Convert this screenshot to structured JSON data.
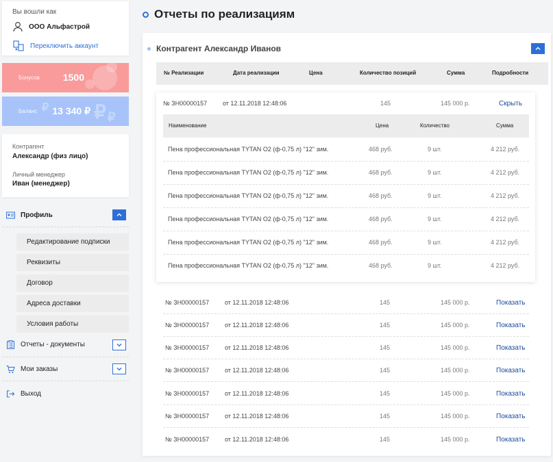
{
  "sidebar": {
    "login_title": "Вы вошли как",
    "company": "ООО Альфастрой",
    "switch_account": "Переключить аккаунт",
    "bonus": {
      "label": "Бонусов",
      "value": "1500"
    },
    "balance": {
      "label": "Баланс",
      "value": "13 340 ₽"
    },
    "contractor_label": "Контрагент",
    "contractor_value": "Александр (физ лицо)",
    "manager_label": "Личный менеджер",
    "manager_value": "Иван (менеджер)",
    "profile_label": "Профиль",
    "profile_items": [
      "Редактирование подписки",
      "Реквизиты",
      "Договор",
      "Адреса доставки",
      "Условия работы"
    ],
    "reports_label": "Отчеты - документы",
    "orders_label": "Мои заказы",
    "logout_label": "Выход"
  },
  "main": {
    "page_title": "Отчеты по реализациям",
    "contractor_name": "Контрагент Александр Иванов",
    "columns": [
      "№ Реализации",
      "Дата реализации",
      "Цена",
      "Количество позиций",
      "Сумма",
      "Подробности"
    ],
    "expanded": {
      "number": "№ ЗН00000157",
      "date": "от 12.11.2018 12:48:06",
      "positions": "145",
      "sum": "145 000 р.",
      "action": "Скрыть",
      "item_columns": [
        "Наименование",
        "Цена",
        "Количество",
        "Сумма"
      ],
      "items": [
        {
          "name": "Пена профессиональная TYTAN O2 (ф-0,75 л) \"12\" зим.",
          "price": "468 руб.",
          "qty": "9 шт.",
          "sum": "4 212 руб."
        },
        {
          "name": "Пена профессиональная TYTAN O2 (ф-0,75 л) \"12\" зим.",
          "price": "468 руб.",
          "qty": "9 шт.",
          "sum": "4 212 руб."
        },
        {
          "name": "Пена профессиональная TYTAN O2 (ф-0,75 л) \"12\" зим.",
          "price": "468 руб.",
          "qty": "9 шт.",
          "sum": "4 212 руб."
        },
        {
          "name": "Пена профессиональная TYTAN O2 (ф-0,75 л) \"12\" зим.",
          "price": "468 руб.",
          "qty": "9 шт.",
          "sum": "4 212 руб."
        },
        {
          "name": "Пена профессиональная TYTAN O2 (ф-0,75 л) \"12\" зим.",
          "price": "468 руб.",
          "qty": "9 шт.",
          "sum": "4 212 руб."
        },
        {
          "name": "Пена профессиональная TYTAN O2 (ф-0,75 л) \"12\" зим.",
          "price": "468 руб.",
          "qty": "9 шт.",
          "sum": "4 212 руб."
        }
      ]
    },
    "rows": [
      {
        "number": "№ ЗН00000157",
        "date": "от 12.11.2018 12:48:06",
        "positions": "145",
        "sum": "145 000 р.",
        "action": "Показать"
      },
      {
        "number": "№ ЗН00000157",
        "date": "от 12.11.2018 12:48:06",
        "positions": "145",
        "sum": "145 000 р.",
        "action": "Показать"
      },
      {
        "number": "№ ЗН00000157",
        "date": "от 12.11.2018 12:48:06",
        "positions": "145",
        "sum": "145 000 р.",
        "action": "Показать"
      },
      {
        "number": "№ ЗН00000157",
        "date": "от 12.11.2018 12:48:06",
        "positions": "145",
        "sum": "145 000 р.",
        "action": "Показать"
      },
      {
        "number": "№ ЗН00000157",
        "date": "от 12.11.2018 12:48:06",
        "positions": "145",
        "sum": "145 000 р.",
        "action": "Показать"
      },
      {
        "number": "№ ЗН00000157",
        "date": "от 12.11.2018 12:48:06",
        "positions": "145",
        "sum": "145 000 р.",
        "action": "Показать"
      },
      {
        "number": "№ ЗН00000157",
        "date": "от 12.11.2018 12:48:06",
        "positions": "145",
        "sum": "145 000 р.",
        "action": "Показать"
      }
    ]
  },
  "colors": {
    "accent": "#2d6fd8",
    "bonus_bg": "#f99b9b",
    "balance_bg": "#a7c3f9",
    "link": "#1a4a9a"
  }
}
